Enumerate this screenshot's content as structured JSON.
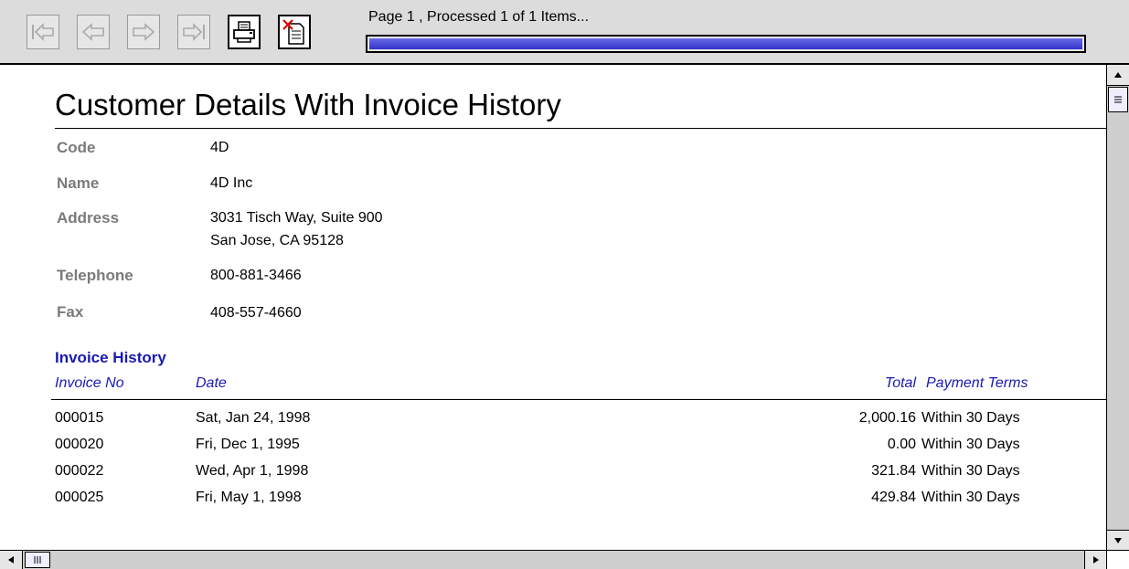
{
  "toolbar": {
    "status_text": "Page 1 , Processed 1 of 1 Items...",
    "progress": 1.0,
    "buttons": [
      "first-page",
      "previous-page",
      "next-page",
      "last-page",
      "print",
      "cancel"
    ]
  },
  "report": {
    "title": "Customer Details With Invoice History",
    "fields": {
      "code_label": "Code",
      "code_value": "4D",
      "name_label": "Name",
      "name_value": "4D Inc",
      "address_label": "Address",
      "address_line1": "3031 Tisch Way, Suite 900",
      "address_line2": "San Jose, CA 95128",
      "telephone_label": "Telephone",
      "telephone_value": "800-881-3466",
      "fax_label": "Fax",
      "fax_value": "408-557-4660"
    },
    "invoice_section": {
      "title": "Invoice History",
      "columns": {
        "invoice_no": "Invoice No",
        "date": "Date",
        "total": "Total",
        "payment_terms": "Payment Terms"
      },
      "rows": [
        {
          "invoice_no": "000015",
          "date": "Sat, Jan 24, 1998",
          "total": "2,000.16",
          "payment_terms": "Within 30 Days"
        },
        {
          "invoice_no": "000020",
          "date": "Fri, Dec 1, 1995",
          "total": "0.00",
          "payment_terms": "Within 30 Days"
        },
        {
          "invoice_no": "000022",
          "date": "Wed, Apr 1, 1998",
          "total": "321.84",
          "payment_terms": "Within 30 Days"
        },
        {
          "invoice_no": "000025",
          "date": "Fri, May 1, 1998",
          "total": "429.84",
          "payment_terms": "Within 30 Days"
        }
      ]
    }
  },
  "colors": {
    "accent_blue": "#1a1ab0",
    "label_gray": "#7a7a7a",
    "progress_fill": "#3232c8"
  }
}
